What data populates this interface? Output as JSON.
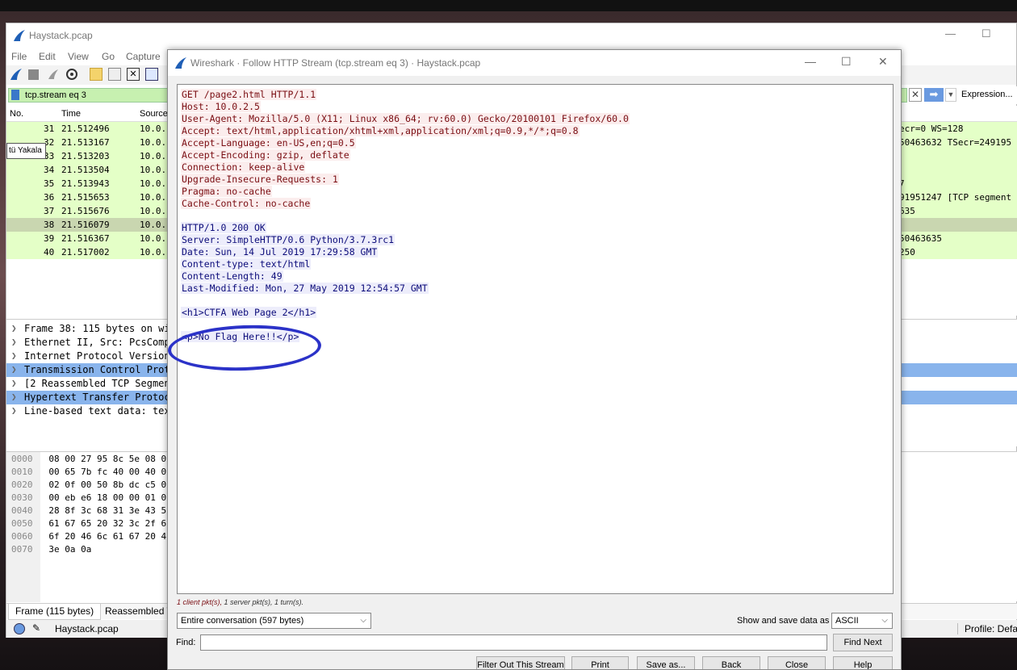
{
  "main_window": {
    "title": "Haystack.pcap",
    "window_controls": {
      "minimize": "—",
      "maximize": "☐"
    },
    "menu": [
      "File",
      "Edit",
      "View",
      "Go",
      "Capture"
    ],
    "filter": {
      "value": "tcp.stream eq 3",
      "clear": "✕",
      "apply": "➡",
      "dropdown": "▼",
      "expression": "Expression..."
    },
    "columns": [
      "No.",
      "Time",
      "Source"
    ],
    "tooltip": "tü Yakala",
    "packets": [
      {
        "no": "31",
        "time": "21.512496",
        "source": "10.0.",
        "info": "ecr=0 WS=128"
      },
      {
        "no": "32",
        "time": "21.513167",
        "source": "10.0.",
        "info": "50463632 TSecr=249195"
      },
      {
        "no": "33",
        "time": "21.513203",
        "source": "10.0.",
        "info": ""
      },
      {
        "no": "34",
        "time": "21.513504",
        "source": "10.0.",
        "info": ""
      },
      {
        "no": "35",
        "time": "21.513943",
        "source": "10.0.",
        "info": "7"
      },
      {
        "no": "36",
        "time": "21.515653",
        "source": "10.0.",
        "info": "91951247 [TCP segment"
      },
      {
        "no": "37",
        "time": "21.515676",
        "source": "10.0.",
        "info": "635"
      },
      {
        "no": "38",
        "time": "21.516079",
        "source": "10.0.",
        "info": ""
      },
      {
        "no": "39",
        "time": "21.516367",
        "source": "10.0.",
        "info": "50463635"
      },
      {
        "no": "40",
        "time": "21.517002",
        "source": "10.0.",
        "info": "250"
      }
    ],
    "details": [
      {
        "text": "Frame 38: 115 bytes on wi",
        "highlight": false
      },
      {
        "text": "Ethernet II, Src: PcsComp",
        "highlight": false
      },
      {
        "text": "Internet Protocol Version",
        "highlight": false
      },
      {
        "text": "Transmission Control Prot",
        "highlight": true
      },
      {
        "text": "[2 Reassembled TCP Segment",
        "highlight": false
      },
      {
        "text": "Hypertext Transfer Protoc",
        "highlight": true
      },
      {
        "text": "Line-based text data: tex",
        "highlight": false
      }
    ],
    "bytes": [
      {
        "offset": "0000",
        "hex": "08 00 27 95 8c 5e 08 0"
      },
      {
        "offset": "0010",
        "hex": "00 65 7b fc 40 00 40 0"
      },
      {
        "offset": "0020",
        "hex": "02 0f 00 50 8b dc c5 0"
      },
      {
        "offset": "0030",
        "hex": "00 eb e6 18 00 00 01 0"
      },
      {
        "offset": "0040",
        "hex": "28 8f 3c 68 31 3e 43 5"
      },
      {
        "offset": "0050",
        "hex": "61 67 65 20 32 3c 2f 6"
      },
      {
        "offset": "0060",
        "hex": "6f 20 46 6c 61 67 20 4"
      },
      {
        "offset": "0070",
        "hex": "3e 0a 0a"
      }
    ],
    "bottom_tabs": [
      "Frame (115 bytes)",
      "Reassembled TC"
    ],
    "status": {
      "file": "Haystack.pcap",
      "profile": "Profile: Defau"
    }
  },
  "dialog": {
    "title": "Wireshark · Follow HTTP Stream (tcp.stream eq 3) · Haystack.pcap",
    "window_controls": {
      "minimize": "—",
      "maximize": "☐",
      "close": "✕"
    },
    "request_lines": [
      "GET /page2.html HTTP/1.1",
      "Host: 10.0.2.5",
      "User-Agent: Mozilla/5.0 (X11; Linux x86_64; rv:60.0) Gecko/20100101 Firefox/60.0",
      "Accept: text/html,application/xhtml+xml,application/xml;q=0.9,*/*;q=0.8",
      "Accept-Language: en-US,en;q=0.5",
      "Accept-Encoding: gzip, deflate",
      "Connection: keep-alive",
      "Upgrade-Insecure-Requests: 1",
      "Pragma: no-cache",
      "Cache-Control: no-cache"
    ],
    "response_lines": [
      "HTTP/1.0 200 OK",
      "Server: SimpleHTTP/0.6 Python/3.7.3rc1",
      "Date: Sun, 14 Jul 2019 17:29:58 GMT",
      "Content-type: text/html",
      "Content-Length: 49",
      "Last-Modified: Mon, 27 May 2019 12:54:57 GMT"
    ],
    "body_lines": [
      "<h1>CTFA Web Page 2</h1>",
      "<p>No Flag Here!!</p>"
    ],
    "summary": {
      "client": "1 client pkt(s),",
      "rest": " 1 server pkt(s), 1 turn(s)."
    },
    "conversation": "Entire conversation (597 bytes)",
    "show_as_label": "Show and save data as",
    "show_as_value": "ASCII",
    "find_label": "Find:",
    "find_value": "",
    "buttons": {
      "find_next": "Find Next",
      "filter_out": "Filter Out This Stream",
      "print": "Print",
      "save_as": "Save as...",
      "back": "Back",
      "close": "Close",
      "help": "Help"
    },
    "annotation_color": "#2b32c8",
    "client_color": "#7a0d12",
    "server_color": "#0c0c7a"
  }
}
